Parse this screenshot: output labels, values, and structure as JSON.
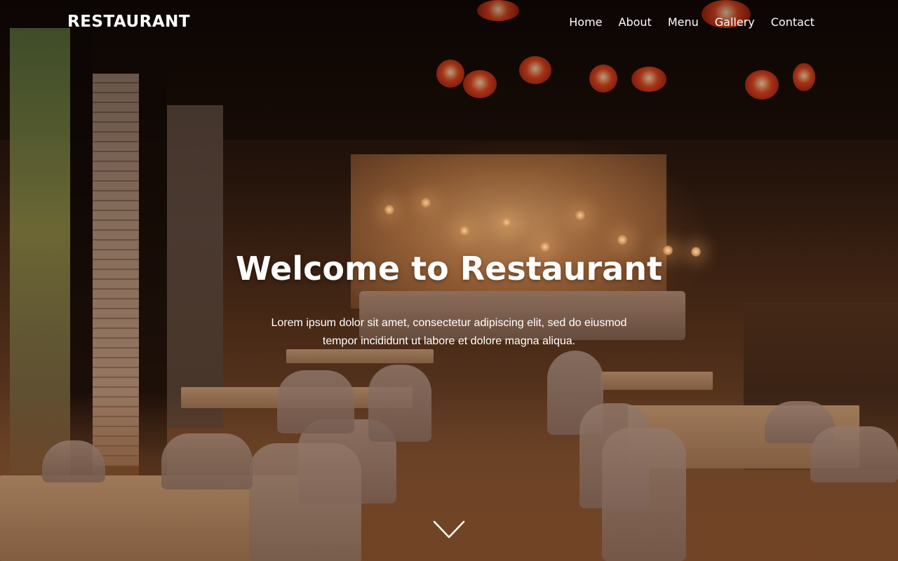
{
  "header": {
    "brand": "RESTAURANT",
    "nav": [
      {
        "label": "Home"
      },
      {
        "label": "About"
      },
      {
        "label": "Menu"
      },
      {
        "label": "Gallery"
      },
      {
        "label": "Contact"
      }
    ]
  },
  "hero": {
    "title": "Welcome to Restaurant",
    "text": "Lorem ipsum dolor sit amet, consectetur adipiscing elit, sed do eiusmod tempor incididunt ut labore et dolore magna aliqua.",
    "scroll_icon": "chevron-down-icon"
  },
  "colors": {
    "text": "#ffffff",
    "accent_lantern": "#e0461f"
  }
}
